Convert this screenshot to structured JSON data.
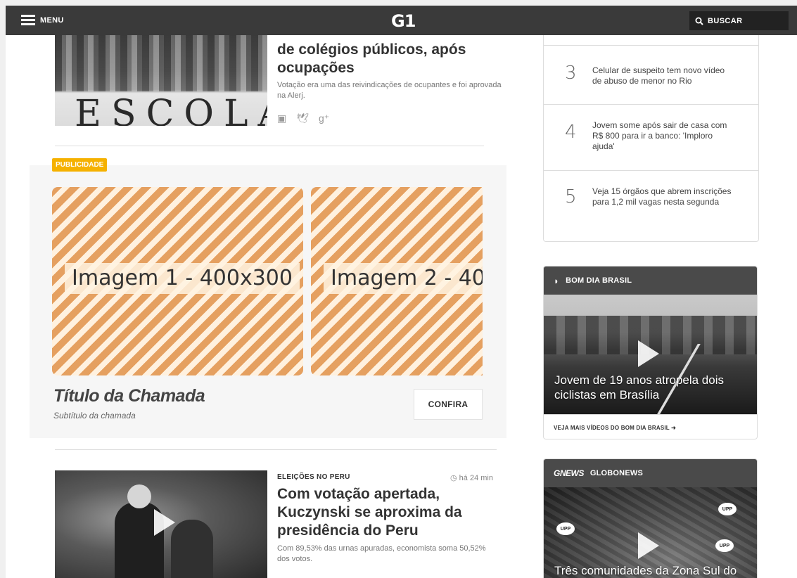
{
  "header": {
    "menu_label": "MENU",
    "logo": "G1",
    "search_label": "BUSCAR"
  },
  "top_story": {
    "image_text": "ESCOLA",
    "title": "de colégios públicos, após ocupações",
    "subtitle": "Votação era uma das reivindicações de ocupantes e foi aprovada na Alerj."
  },
  "share_icons": [
    "facebook-icon",
    "twitter-icon",
    "google-plus-icon"
  ],
  "ad": {
    "badge": "PUBLICIDADE",
    "image1_label": "Imagem 1 - 400x300",
    "image2_label": "Imagem 2 - 40",
    "title": "Título da Chamada",
    "subtitle": "Subtítulo da chamada",
    "cta": "CONFIRA"
  },
  "second_story": {
    "category": "ELEIÇÕES NO PERU",
    "time": "há 24 min",
    "title": "Com votação apertada, Kuczynski se aproxima da presidência do Peru",
    "subtitle": "Com 89,53% das urnas apuradas, economista soma 50,52% dos votos."
  },
  "most_read": [
    {
      "num": "3",
      "text": "Celular de suspeito tem novo vídeo de abuso de menor no Rio"
    },
    {
      "num": "4",
      "text": "Jovem some após sair de casa com R$ 800 para ir a banco: 'Imploro ajuda'"
    },
    {
      "num": "5",
      "text": "Veja 15 órgãos que abrem inscrições para 1,2 mil vagas nesta segunda"
    }
  ],
  "bom_dia": {
    "title": "BOM DIA BRASIL",
    "caption": "Jovem de 19 anos atropela dois ciclistas em Brasília",
    "more": "VEJA MAIS VÍDEOS DO BOM DIA BRASIL ➜"
  },
  "globonews": {
    "logo": "GNEWS",
    "title": "GLOBONEWS",
    "caption": "Três comunidades da Zona Sul do",
    "upp": "UPP"
  }
}
